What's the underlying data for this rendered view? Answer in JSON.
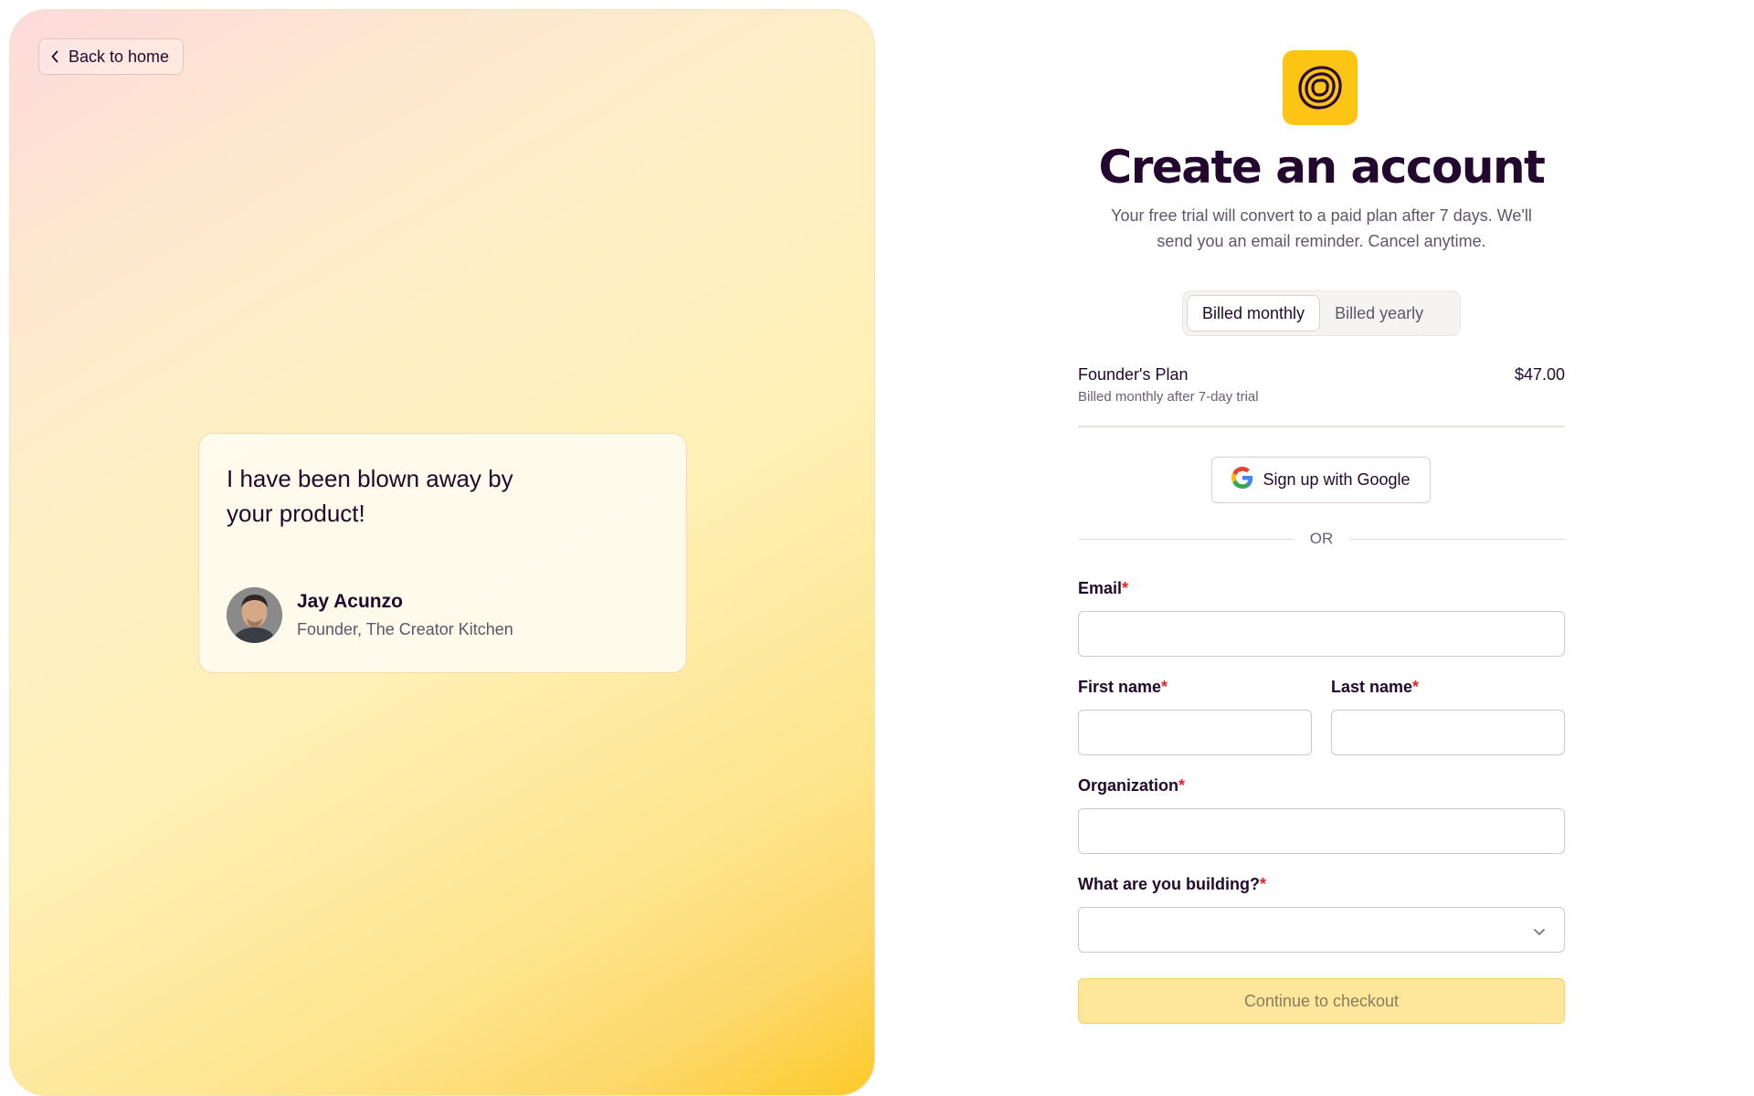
{
  "left": {
    "back_label": "Back to home",
    "testimonial": {
      "quote": "I have been blown away by your product!",
      "author_name": "Jay Acunzo",
      "author_title": "Founder, The Creator Kitchen"
    }
  },
  "form": {
    "title": "Create an account",
    "subtitle": "Your free trial will convert to a paid plan after 7 days. We'll send you an email reminder. Cancel anytime.",
    "billing": {
      "monthly_label": "Billed monthly",
      "yearly_label": "Billed yearly",
      "selected": "monthly"
    },
    "plan": {
      "name": "Founder's Plan",
      "detail": "Billed monthly after 7-day trial",
      "price": "$47.00"
    },
    "google_label": "Sign up with Google",
    "or_label": "OR",
    "fields": {
      "email_label": "Email",
      "first_name_label": "First name",
      "last_name_label": "Last name",
      "organization_label": "Organization",
      "building_label": "What are you building?",
      "required_mark": "*"
    },
    "submit_label": "Continue to checkout"
  },
  "colors": {
    "brand_yellow": "#fcc516",
    "text_dark": "#1f0a2b",
    "required_red": "#e0242c"
  }
}
